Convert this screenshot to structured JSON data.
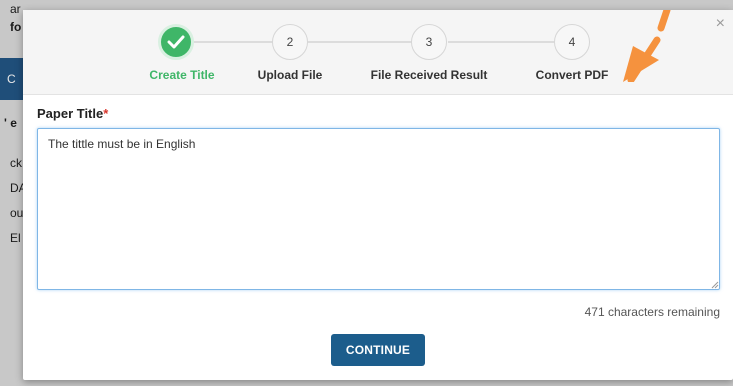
{
  "background": {
    "fragments": [
      "ar",
      "fo",
      "C",
      "' e",
      "ck",
      "DA",
      "ou",
      "El"
    ]
  },
  "modal": {
    "close_label": "×",
    "steps": [
      {
        "number": "",
        "label": "Create Title",
        "state": "done"
      },
      {
        "number": "2",
        "label": "Upload File",
        "state": "pending"
      },
      {
        "number": "3",
        "label": "File Received Result",
        "state": "pending"
      },
      {
        "number": "4",
        "label": "Convert PDF",
        "state": "pending"
      }
    ],
    "field": {
      "label": "Paper Title",
      "required_mark": "*",
      "value": "The tittle must be in English"
    },
    "remaining": "471 characters remaining",
    "continue_label": "CONTINUE"
  },
  "colors": {
    "done": "#3fb668",
    "primary": "#1c5d8c",
    "annotation_arrow": "#f5923e"
  }
}
